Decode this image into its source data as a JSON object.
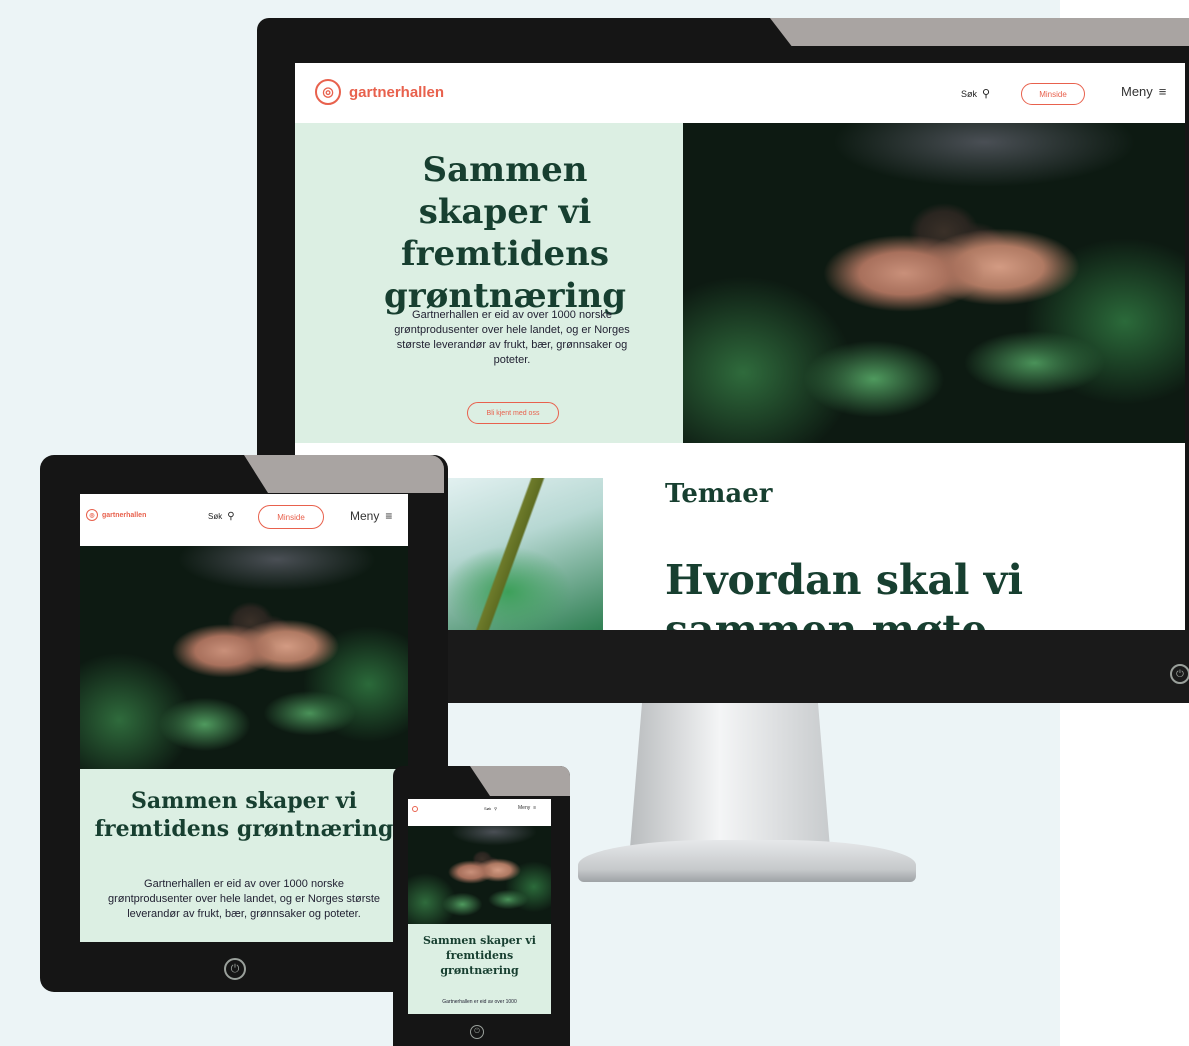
{
  "brand": {
    "name": "gartnerhallen",
    "accent_color": "#e8614d",
    "dark_green": "#173f30",
    "mint_bg": "#dcefe3"
  },
  "nav": {
    "search_label": "Søk",
    "search_icon": "search-icon",
    "mypage_label": "Minside",
    "menu_label": "Meny",
    "menu_icon": "hamburger-icon"
  },
  "hero": {
    "title": "Sammen skaper vi fremtidens grøntnæring",
    "body": "Gartnerhallen er eid av over 1000 norske grøntprodusenter over hele landet, og er Norges største leverandør av frukt, bær, grønnsaker og poteter.",
    "cta": "Bli kjent med oss"
  },
  "themes": {
    "label": "Temaer",
    "headline": "Hvordan skal vi",
    "headline_cut": "sammen møte"
  },
  "phone": {
    "body_snippet": "Gartnerhallen er eid av over 1000"
  },
  "devices": {
    "power_glyph": "⏻"
  }
}
